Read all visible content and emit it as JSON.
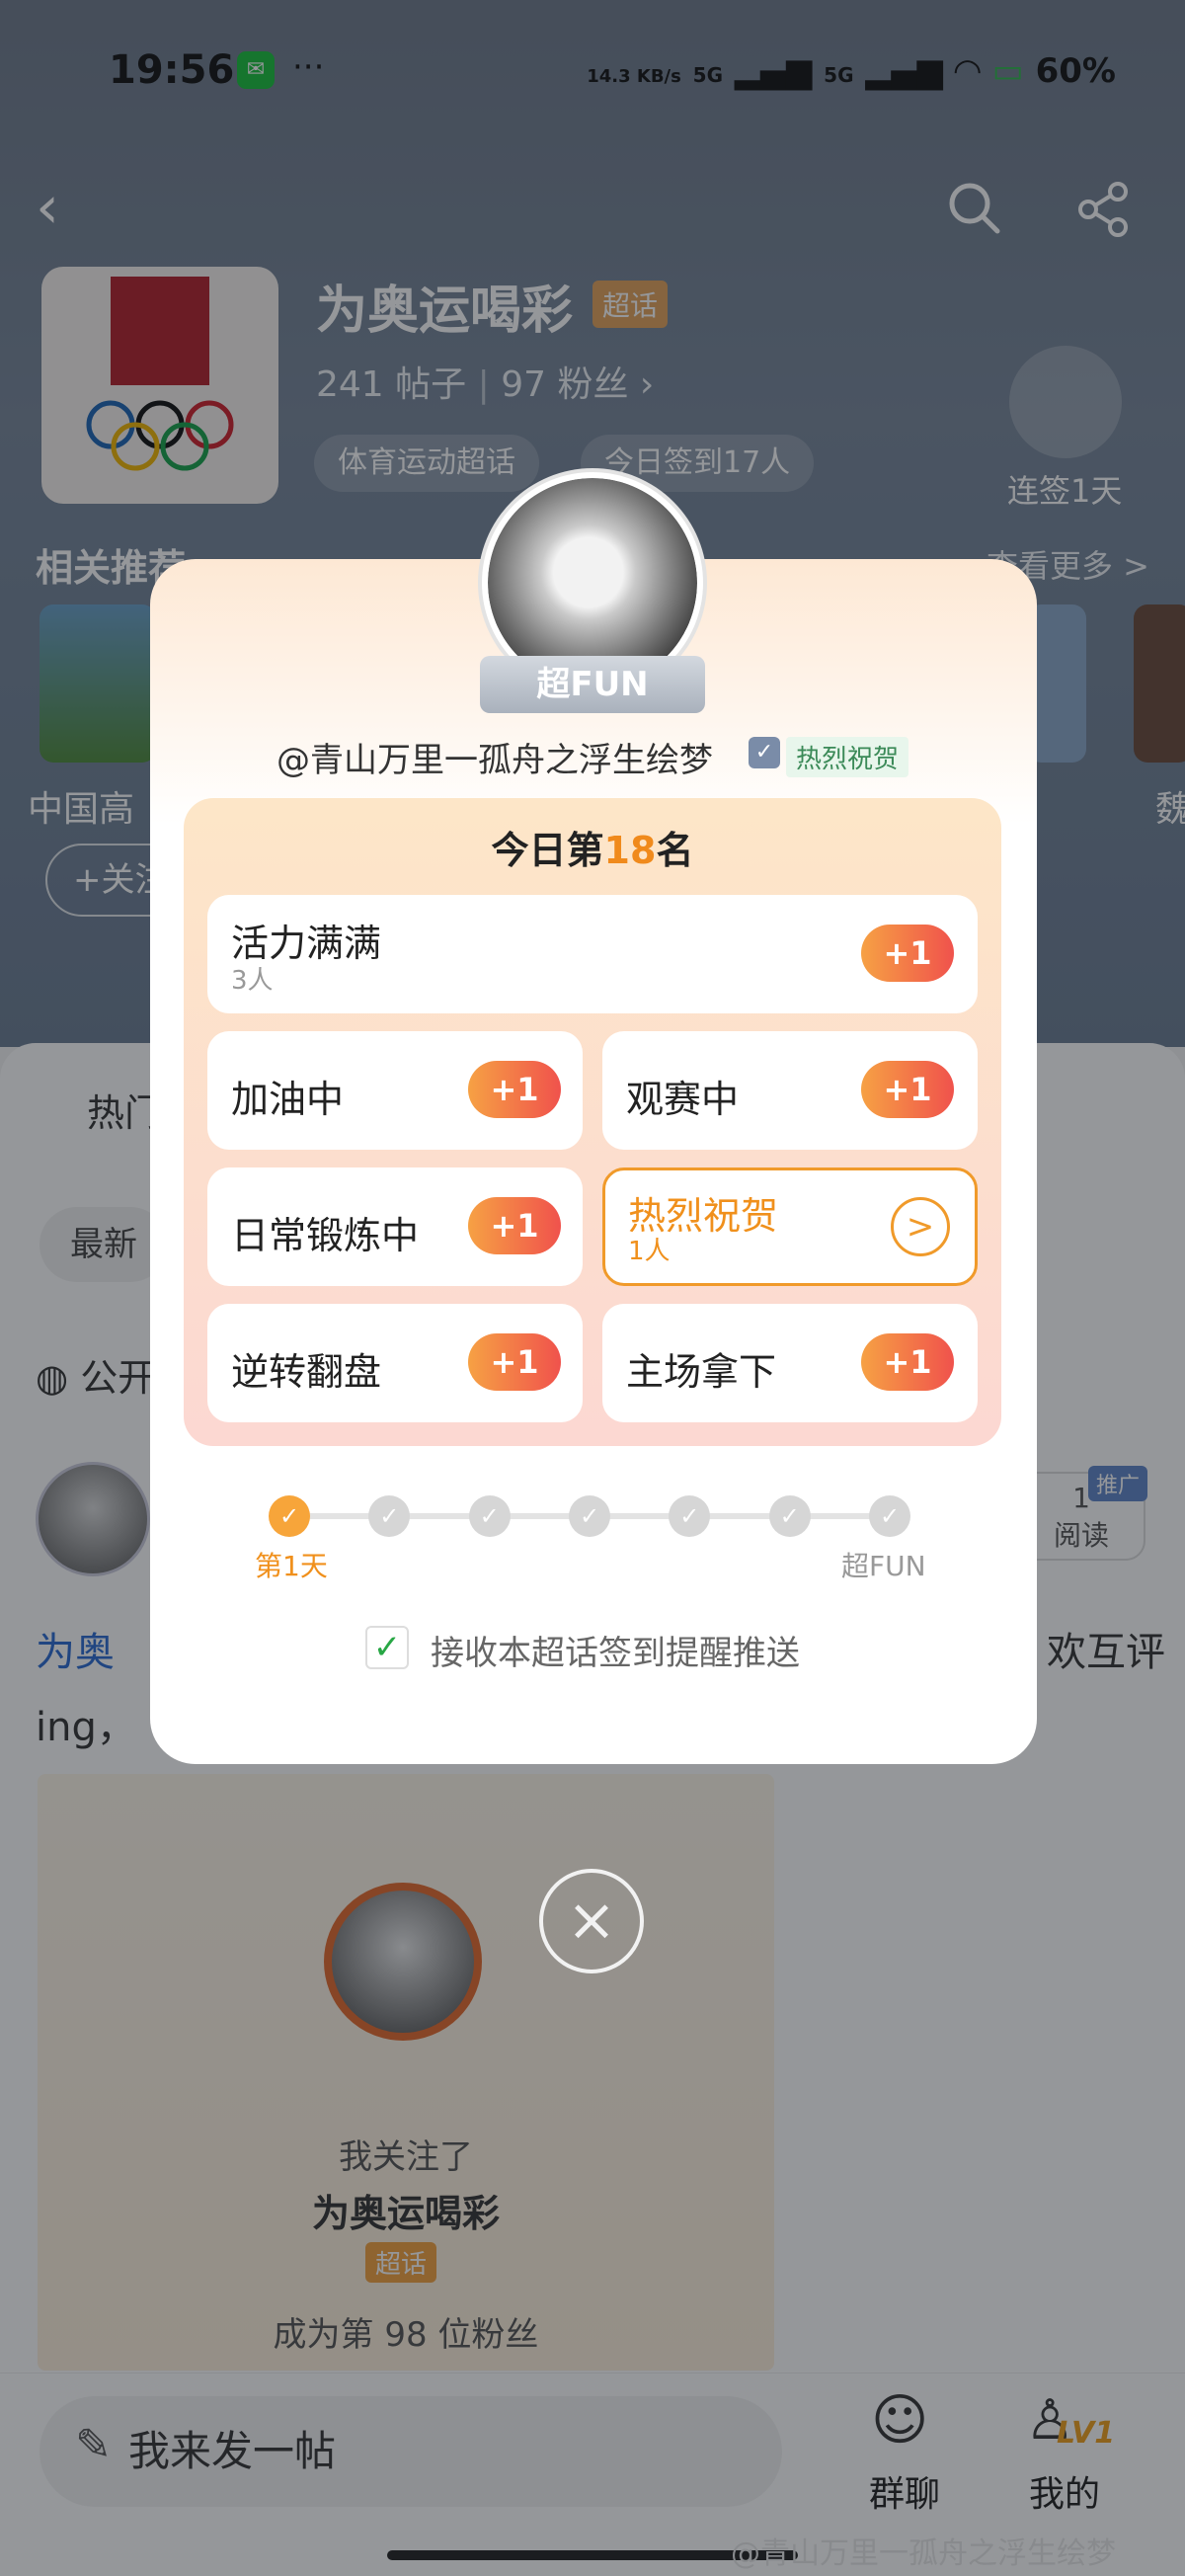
{
  "status_bar": {
    "time": "19:56",
    "app_icon": "wechat-icon",
    "more": "···",
    "network_speed": "14.3 KB/s",
    "signal_1": "5G",
    "signal_2": "5G",
    "battery": "60%"
  },
  "header": {
    "back_icon": "chevron-left-icon",
    "search_icon": "search-icon",
    "share_icon": "share-icon",
    "topic_title": "为奥运喝彩",
    "topic_badge": "超话",
    "posts": "241 帖子",
    "fans": "97 粉丝",
    "chip_category": "体育运动超话",
    "chip_checkins": "今日签到17人",
    "streak_label": "连签1天"
  },
  "related": {
    "title": "相关推荐",
    "more": "查看更多 >",
    "item1_name": "中国高",
    "item2_name": "魏",
    "follow_label": "+关注"
  },
  "feed": {
    "tab_hot": "热门",
    "sort_latest": "最新",
    "public_label": "公开",
    "read_count": "1",
    "read_label": "阅读",
    "promo_tag": "推广",
    "post_line1": "为奥",
    "post_line1_right": "欢互评",
    "post_line2": "ing，",
    "card": {
      "line1": "我关注了",
      "line2": "为奥运喝彩",
      "badge": "超话",
      "line3": "成为第 98 位粉丝"
    }
  },
  "bottom_bar": {
    "compose_placeholder": "我来发一帖",
    "group_chat": "群聊",
    "mine": "我的",
    "level": "LV1"
  },
  "watermark": "@青山万里一孤舟之浮生绘梦",
  "modal": {
    "fan_level": "超FUN",
    "username": "@青山万里一孤舟之浮生绘梦",
    "status_tag": "热烈祝贺",
    "rank_prefix": "今日第",
    "rank_number": "18",
    "rank_suffix": "名",
    "moods": [
      {
        "title": "活力满满",
        "sub": "3人",
        "action": "+1"
      },
      {
        "title": "加油中",
        "sub": "",
        "action": "+1"
      },
      {
        "title": "观赛中",
        "sub": "",
        "action": "+1"
      },
      {
        "title": "日常锻炼中",
        "sub": "",
        "action": "+1"
      },
      {
        "title": "热烈祝贺",
        "sub": "1人",
        "action": ">"
      },
      {
        "title": "逆转翻盘",
        "sub": "",
        "action": "+1"
      },
      {
        "title": "主场拿下",
        "sub": "",
        "action": "+1"
      }
    ],
    "progress_start": "第1天",
    "progress_end": "超FUN",
    "progress_days_done": 1,
    "progress_days_total": 7,
    "remind_checked": true,
    "remind_text": "接收本超话签到提醒推送",
    "close_icon": "close-icon"
  },
  "colors": {
    "accent_orange": "#f0901c",
    "plus_gradient_start": "#f6a144",
    "plus_gradient_end": "#f0524c",
    "check_green": "#28a745"
  }
}
